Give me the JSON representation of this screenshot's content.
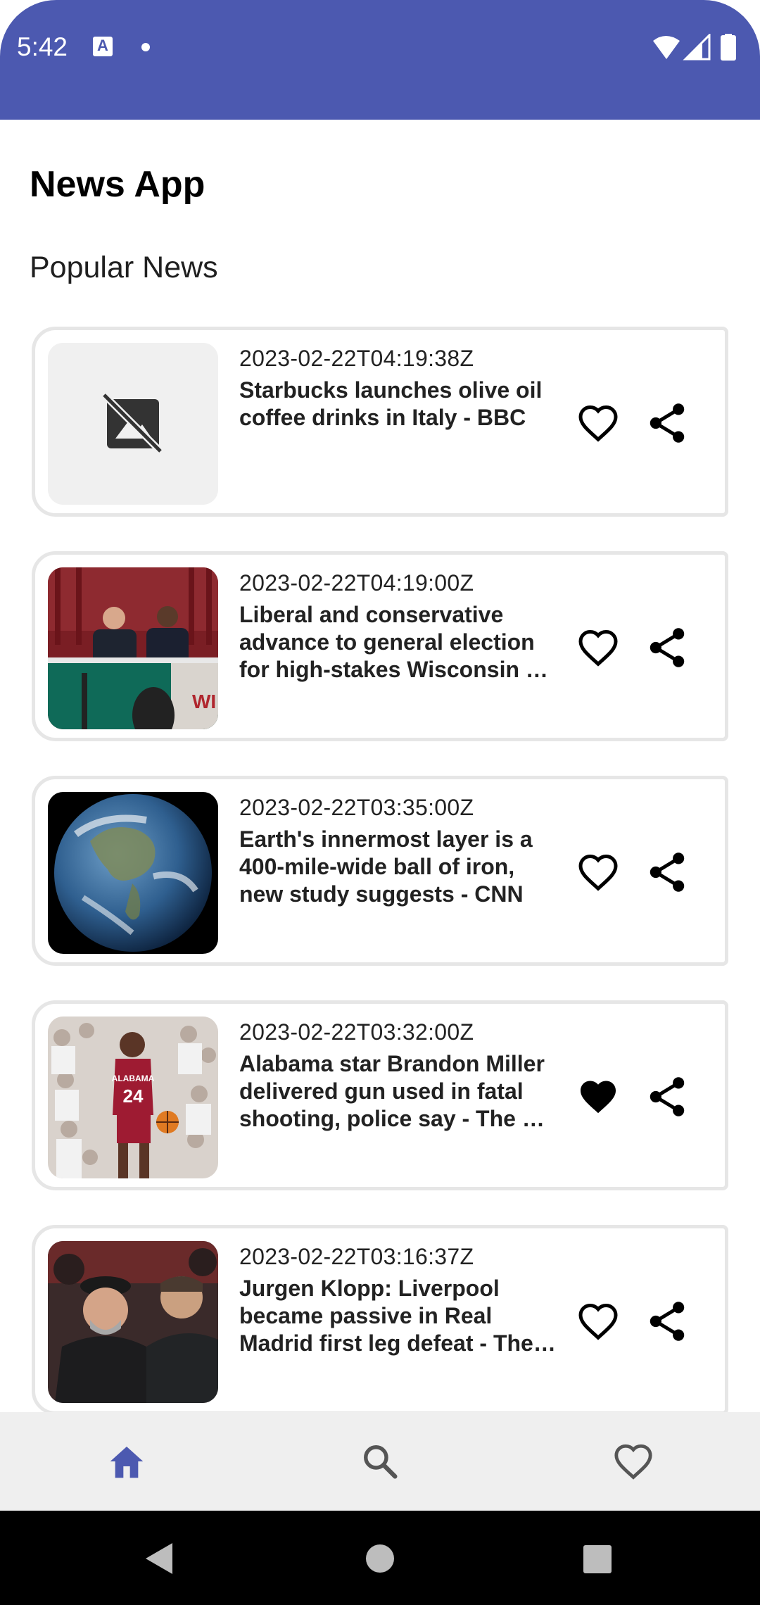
{
  "status_bar": {
    "time": "5:42",
    "notification_icon": "A",
    "background": "#4c59b0",
    "icons": [
      "wifi-icon",
      "signal-icon",
      "battery-icon"
    ]
  },
  "app": {
    "title": "News App",
    "section_title": "Popular News"
  },
  "articles": [
    {
      "date": "2023-02-22T04:19:38Z",
      "title_lines": [
        "Starbucks launches olive oil",
        "coffee drinks in Italy - BBC"
      ],
      "image": "broken-image-placeholder",
      "favorited": false
    },
    {
      "date": "2023-02-22T04:19:00Z",
      "title_lines": [
        "Liberal and conservative",
        "advance to general election",
        "for high-stakes Wisconsin S…"
      ],
      "image": "debate-panel-photo",
      "favorited": false
    },
    {
      "date": "2023-02-22T03:35:00Z",
      "title_lines": [
        "Earth's innermost layer is a",
        "400-mile-wide ball of iron,",
        "new study suggests - CNN"
      ],
      "image": "earth-globe-photo",
      "favorited": false
    },
    {
      "date": "2023-02-22T03:32:00Z",
      "title_lines": [
        "Alabama star Brandon Miller",
        "delivered gun used in fatal",
        "shooting, police say - The W…"
      ],
      "image": "basketball-player-photo",
      "jersey_text": "ALABAMA 24",
      "favorited": true
    },
    {
      "date": "2023-02-22T03:16:37Z",
      "title_lines": [
        "Jurgen Klopp: Liverpool",
        "became passive in Real",
        "Madrid first leg defeat - The…"
      ],
      "image": "football-coach-photo",
      "favorited": false
    }
  ],
  "bottom_nav": {
    "items": [
      {
        "name": "home",
        "icon": "home-icon",
        "active": true
      },
      {
        "name": "search",
        "icon": "search-icon",
        "active": false
      },
      {
        "name": "favorites",
        "icon": "heart-icon",
        "active": false
      }
    ],
    "active_color": "#4c59b0",
    "inactive_color": "#555555"
  },
  "system_nav": [
    "back-icon",
    "home-circle-icon",
    "recents-icon"
  ]
}
